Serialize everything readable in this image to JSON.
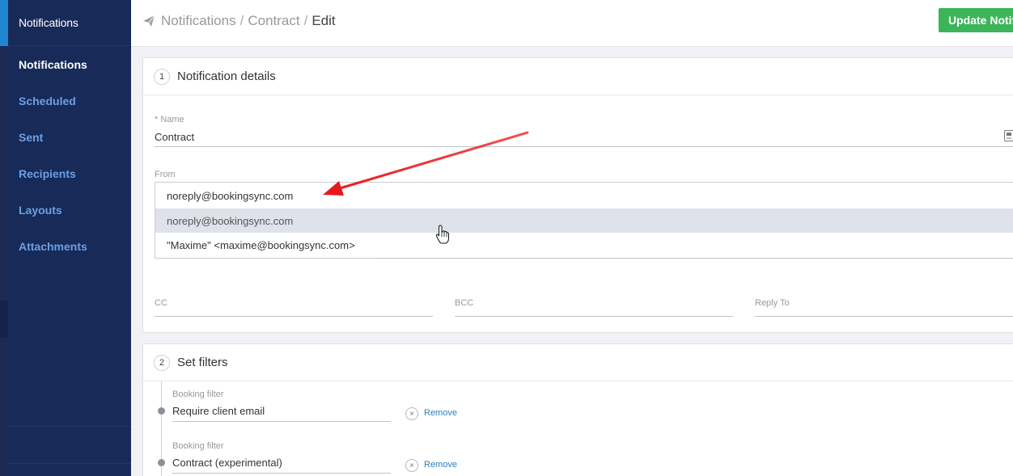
{
  "sidebar": {
    "header": "Notifications",
    "items": [
      {
        "label": "Notifications",
        "active": true
      },
      {
        "label": "Scheduled",
        "active": false
      },
      {
        "label": "Sent",
        "active": false
      },
      {
        "label": "Recipients",
        "active": false
      },
      {
        "label": "Layouts",
        "active": false
      },
      {
        "label": "Attachments",
        "active": false
      }
    ]
  },
  "header": {
    "breadcrumb": [
      "Notifications",
      "Contract",
      "Edit"
    ],
    "separator": "/",
    "update_button": "Update Notific"
  },
  "details": {
    "step": "1",
    "title": "Notification details",
    "name_label": "* Name",
    "name_value": "Contract",
    "from_label": "From",
    "from_value": "noreply@bookingsync.com",
    "from_options": [
      "noreply@bookingsync.com",
      "\"Maxime\" <maxime@bookingsync.com>"
    ],
    "cc_label": "CC",
    "bcc_label": "BCC",
    "replyto_label": "Reply To"
  },
  "filters": {
    "step": "2",
    "title": "Set filters",
    "items": [
      {
        "label": "Booking filter",
        "value": "Require client email",
        "remove": "Remove"
      },
      {
        "label": "Booking filter",
        "value": "Contract (experimental)",
        "remove": "Remove"
      }
    ],
    "remove_glyph": "×"
  },
  "colors": {
    "sidebar": "#172a58",
    "accent": "#1f86d2",
    "primary_button": "#3cb55a",
    "link": "#2a7fc0",
    "annotation_arrow": "#e8191c"
  },
  "icons": {
    "breadcrumb": "paper-plane-icon",
    "name_field": "document-icon",
    "cursor": "hand-pointer-icon"
  }
}
